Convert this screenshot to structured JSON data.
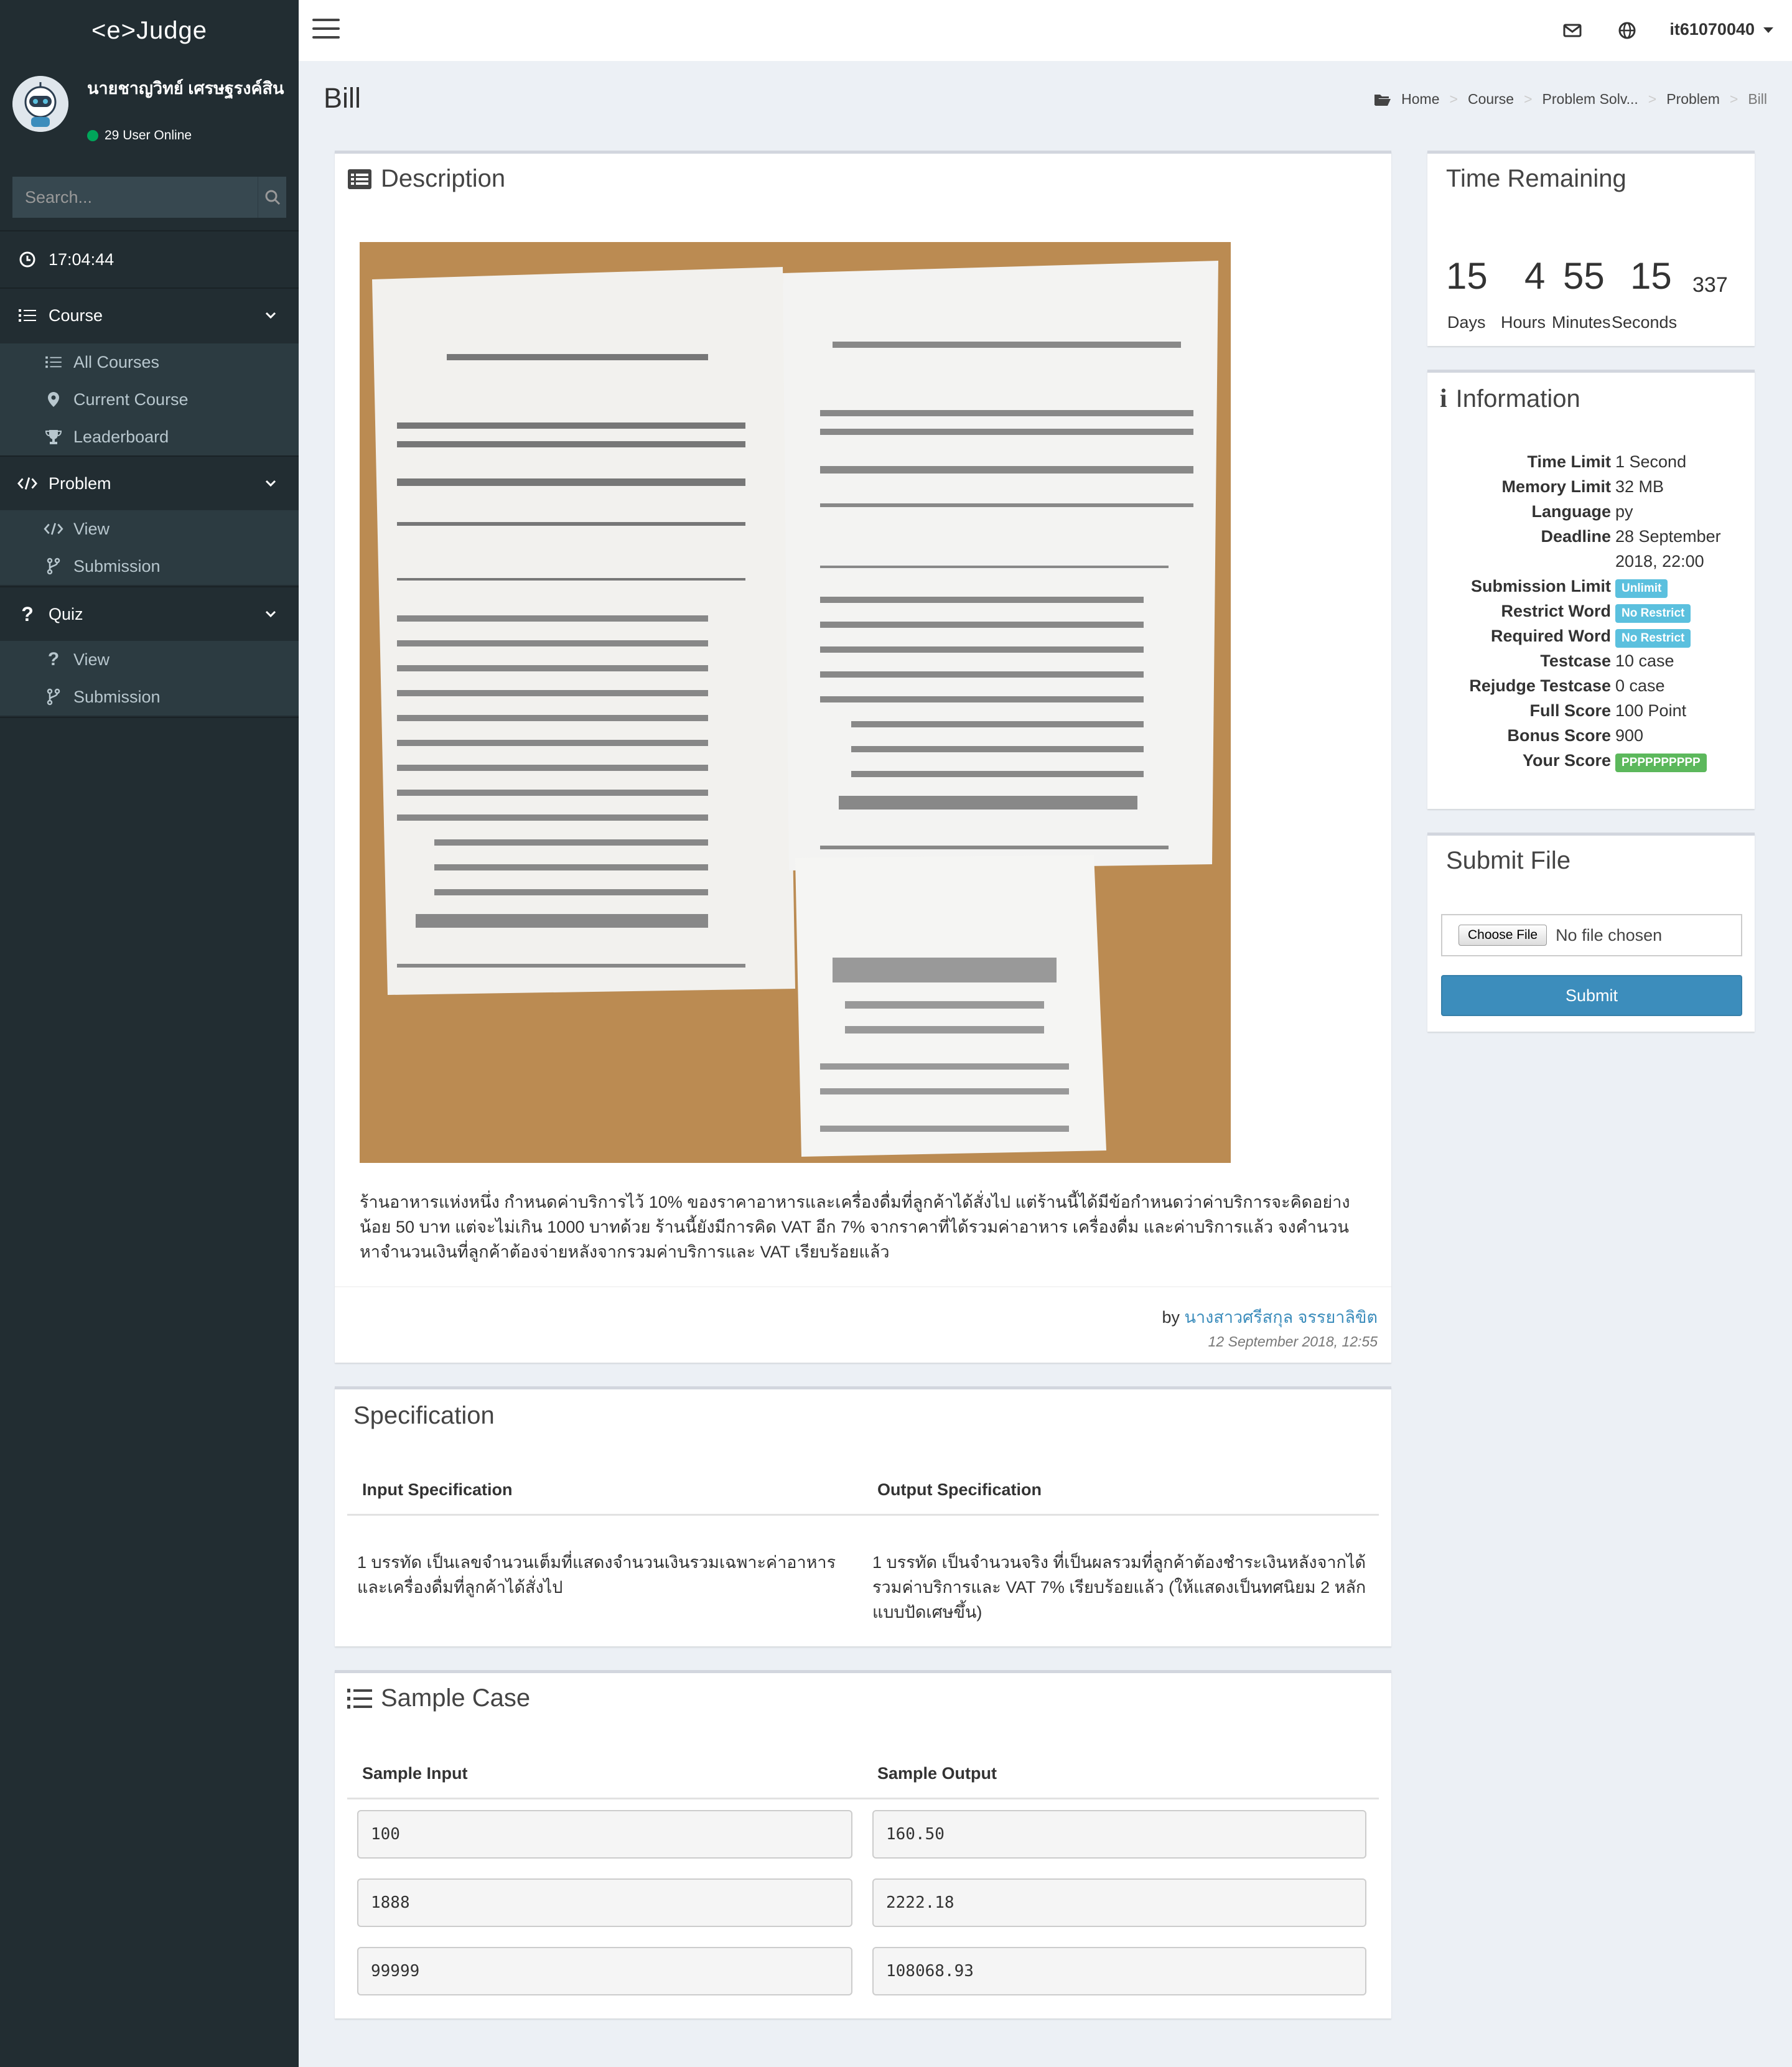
{
  "app": {
    "logo": "<e>Judge"
  },
  "user": {
    "name": "นายชาญวิทย์ เศรษฐรงค์สิน",
    "online": "29 User Online",
    "username": "it61070040"
  },
  "search": {
    "placeholder": "Search..."
  },
  "clock": "17:04:44",
  "sidebar": {
    "course": {
      "label": "Course",
      "items": [
        "All Courses",
        "Current Course",
        "Leaderboard"
      ]
    },
    "problem": {
      "label": "Problem",
      "items": [
        "View",
        "Submission"
      ]
    },
    "quiz": {
      "label": "Quiz",
      "items": [
        "View",
        "Submission"
      ]
    }
  },
  "page": {
    "title": "Bill"
  },
  "breadcrumb": [
    "Home",
    "Course",
    "Problem Solv...",
    "Problem",
    "Bill"
  ],
  "description": {
    "title": "Description",
    "image_alt": "receipt photo",
    "text": "ร้านอาหารแห่งหนึ่ง กำหนดค่าบริการไว้ 10% ของราคาอาหารและเครื่องดื่มที่ลูกค้าได้สั่งไป แต่ร้านนี้ได้มีข้อกำหนดว่าค่าบริการจะคิดอย่างน้อย 50 บาท แต่จะไม่เกิน 1000 บาทด้วย ร้านนี้ยังมีการคิด VAT อีก 7% จากราคาที่ได้รวมค่าอาหาร เครื่องดื่ม และค่าบริการแล้ว จงคำนวนหาจำนวนเงินที่ลูกค้าต้องจ่ายหลังจากรวมค่าบริการและ VAT เรียบร้อยแล้ว",
    "by_prefix": "by",
    "author": "นางสาวศรีสกุล จรรยาลิขิต",
    "date": "12 September 2018, 12:55"
  },
  "specification": {
    "title": "Specification",
    "input_header": "Input Specification",
    "output_header": "Output Specification",
    "input_text": "1 บรรทัด เป็นเลขจำนวนเต็มที่แสดงจำนวนเงินรวมเฉพาะค่าอาหารและเครื่องดื่มที่ลูกค้าได้สั่งไป",
    "output_text": "1 บรรทัด เป็นจำนวนจริง ที่เป็นผลรวมที่ลูกค้าต้องชำระเงินหลังจากได้รวมค่าบริการและ VAT 7% เรียบร้อยแล้ว (ให้แสดงเป็นทศนิยม 2 หลักแบบปัดเศษขึ้น)"
  },
  "samples": {
    "title": "Sample Case",
    "input_header": "Sample Input",
    "output_header": "Sample Output",
    "rows": [
      {
        "input": "100",
        "output": "160.50"
      },
      {
        "input": "1888",
        "output": "2222.18"
      },
      {
        "input": "99999",
        "output": "108068.93"
      }
    ]
  },
  "time_remaining": {
    "title": "Time Remaining",
    "days": "15",
    "hours": "4",
    "minutes": "55",
    "seconds": "15",
    "ms": "337",
    "labels": {
      "days": "Days",
      "hours": "Hours",
      "minutes": "Minutes",
      "seconds": "Seconds"
    }
  },
  "information": {
    "title": "Information",
    "time_limit": {
      "k": "Time Limit",
      "v": "1 Second"
    },
    "memory_limit": {
      "k": "Memory Limit",
      "v": "32 MB"
    },
    "language": {
      "k": "Language",
      "v": "py"
    },
    "deadline": {
      "k": "Deadline",
      "v1": "28 September",
      "v2": "2018, 22:00"
    },
    "submission_limit": {
      "k": "Submission Limit",
      "v": "Unlimit"
    },
    "restrict_word": {
      "k": "Restrict Word",
      "v": "No Restrict"
    },
    "required_word": {
      "k": "Required Word",
      "v": "No Restrict"
    },
    "testcase": {
      "k": "Testcase",
      "v": "10 case"
    },
    "rejudge": {
      "k": "Rejudge Testcase",
      "v": "0 case"
    },
    "full_score": {
      "k": "Full Score",
      "v": "100 Point"
    },
    "bonus_score": {
      "k": "Bonus Score",
      "v": "900"
    },
    "your_score": {
      "k": "Your Score",
      "v": "PPPPPPPPPP"
    }
  },
  "submit_file": {
    "title": "Submit File",
    "choose": "Choose File",
    "no_file": "No file chosen",
    "submit": "Submit"
  },
  "colors": {
    "sidebar": "#222d32",
    "accent": "#3c8dbc",
    "badge_info": "#5bc0de",
    "badge_success": "#5cb85c"
  }
}
